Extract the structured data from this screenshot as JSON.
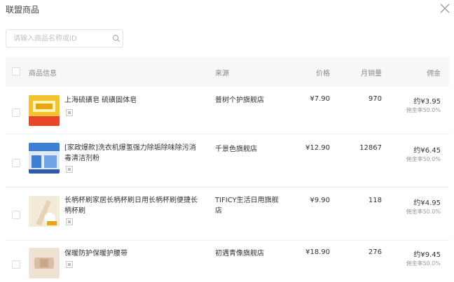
{
  "header": {
    "title": "联盟商品"
  },
  "search": {
    "placeholder": "请输入商品名称或ID"
  },
  "table": {
    "columns": [
      "商品信息",
      "来源",
      "价格",
      "月销量",
      "佣金"
    ],
    "rows": [
      {
        "name": "上海硫磺皂 硫磺固体皂",
        "shop": "普树个护旗舰店",
        "price": "¥7.90",
        "sales": "970",
        "commission": "约¥3.95",
        "rate": "佣金率50.0%",
        "thumb_colors": [
          "#f2c230",
          "#e8462b"
        ]
      },
      {
        "name": "[家政爆款]洗衣机爆氢强力除垢除味除污消毒清洁剂粉",
        "shop": "千景色旗舰店",
        "price": "¥12.90",
        "sales": "12867",
        "commission": "约¥6.45",
        "rate": "佣金率50.0%",
        "thumb_colors": [
          "#3f7fd3",
          "#dfe9f7"
        ]
      },
      {
        "name": "长柄杯刷家居长柄杯刷日用长柄杯刷便捷长柄杯刷",
        "shop": "TIFICY生活日用旗舰店",
        "price": "¥9.90",
        "sales": "118",
        "commission": "约¥4.95",
        "rate": "佣金率50.0%",
        "thumb_colors": [
          "#e6d3b3",
          "#f4ead8"
        ]
      },
      {
        "name": "保暖防护保暖护腰带",
        "shop": "初遇青像旗舰店",
        "price": "¥18.90",
        "sales": "276",
        "commission": "约¥9.45",
        "rate": "佣金率50.0%",
        "thumb_colors": [
          "#d9bfa6",
          "#efe2d5"
        ]
      }
    ]
  },
  "icons": {
    "close": "close-icon",
    "search": "search-icon",
    "tag": "tag-icon"
  }
}
